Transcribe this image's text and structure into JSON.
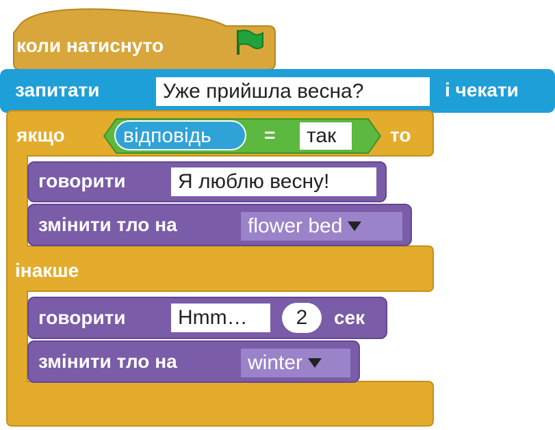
{
  "hat": {
    "label": "коли натиснуто",
    "icon": "green-flag-icon"
  },
  "ask": {
    "label": "запитати",
    "question": "Уже прийшла весна?",
    "wait_label": "і чекати"
  },
  "if_block": {
    "if_label": "якщо",
    "answer_label": "відповідь",
    "operator": "=",
    "compare_value": "так",
    "then_label": "то",
    "else_label": "інакше"
  },
  "then_branch": {
    "say_label": "говорити",
    "say_text": "Я люблю весну!",
    "switch_label": "змінити тло на",
    "switch_value": "flower bed"
  },
  "else_branch": {
    "say_label": "говорити",
    "say_text": "Hmm…",
    "say_seconds": "2",
    "seconds_label": "сек",
    "switch_label": "змінити тло на",
    "switch_value": "winter"
  },
  "colors": {
    "events": "#d8a63a",
    "sensing": "#1f9fd8",
    "control": "#e3ac2c",
    "looks": "#7a5ca8",
    "operators": "#5cb83e",
    "flag": "#1f9a3a"
  }
}
